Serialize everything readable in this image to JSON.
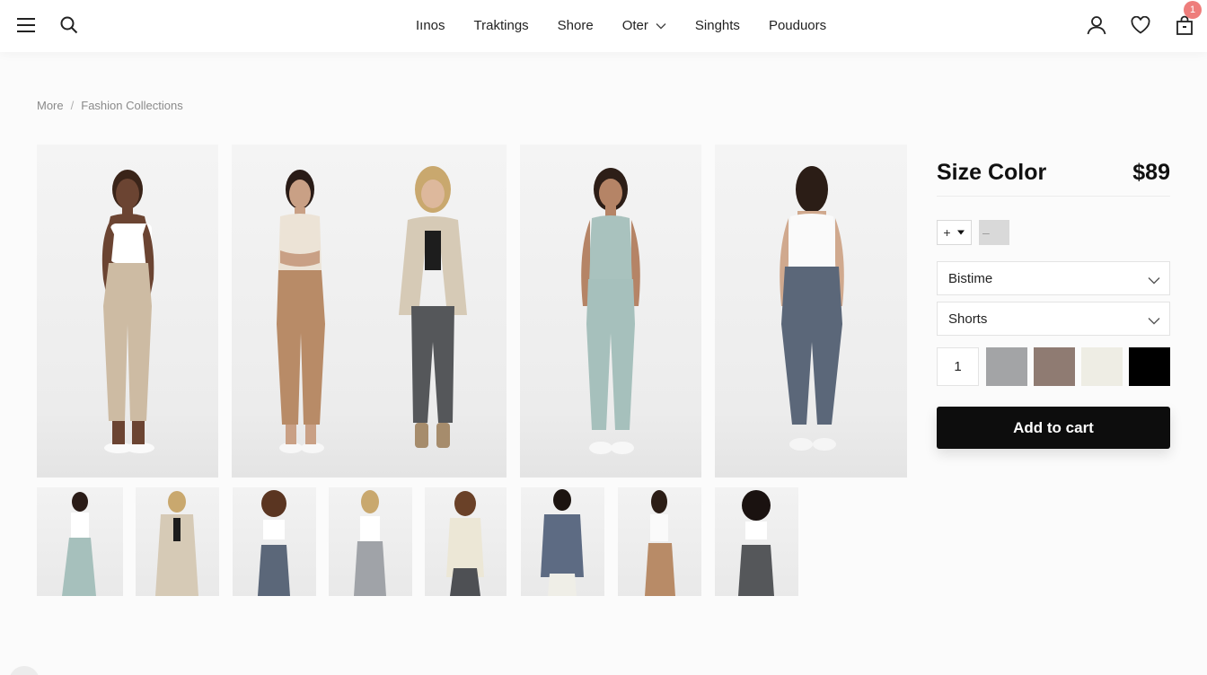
{
  "header": {
    "nav": [
      "Iınos",
      "Traktings",
      "Shore",
      "Oter",
      "Singhts",
      "Pouduors"
    ],
    "cart_count": "1",
    "icons": [
      "menu-icon",
      "search-icon",
      "chevron-down-icon",
      "user-icon",
      "heart-icon",
      "bag-icon"
    ]
  },
  "breadcrumb": {
    "home": "More",
    "separator": "/",
    "current": "Fashion Collections"
  },
  "product": {
    "title": "Size Color",
    "price": "$89",
    "plus": "+",
    "minus": "–",
    "select_1": "Bistime",
    "select_2": "Shorts",
    "quantity": "1",
    "swatches": [
      "#a3a4a6",
      "#8f7b72",
      "#eeede4",
      "#000000"
    ],
    "add_to_cart": "Add to cart"
  }
}
